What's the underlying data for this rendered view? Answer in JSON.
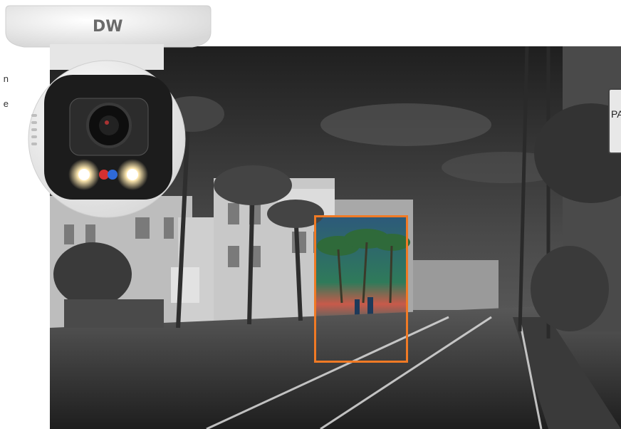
{
  "brand": {
    "logo_text": "DW",
    "accent_color": "#f07a25"
  },
  "side_text": {
    "line1": "n",
    "line2": "e"
  },
  "scene": {
    "description_colors": {
      "sky": "#3a3a3a",
      "street": "#2a2a2a",
      "highlight": "#f07a25"
    }
  },
  "sign": {
    "partial_text": "PA"
  }
}
